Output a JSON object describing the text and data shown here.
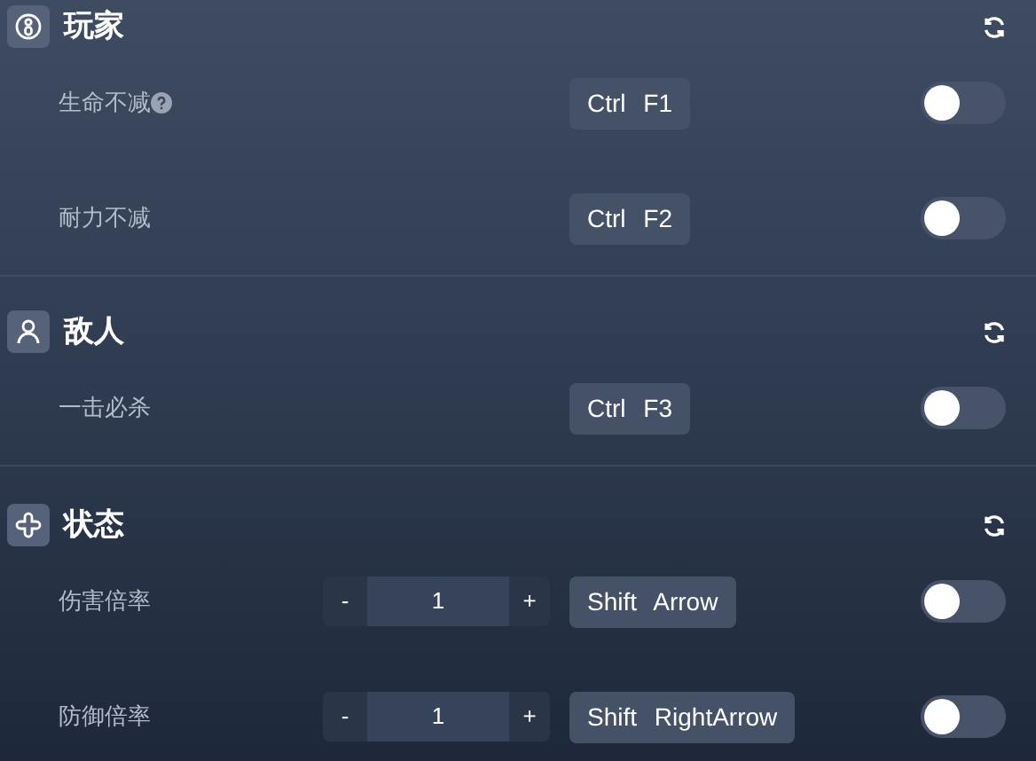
{
  "sections": [
    {
      "title": "玩家",
      "kind": "player",
      "rows": [
        {
          "label": "生命不减",
          "help": true,
          "hotkey": "Ctrl F1",
          "on": false
        },
        {
          "label": "耐力不减",
          "help": false,
          "hotkey": "Ctrl F2",
          "on": false
        }
      ]
    },
    {
      "title": "敌人",
      "kind": "enemy",
      "rows": [
        {
          "label": "一击必杀",
          "help": false,
          "hotkey": "Ctrl F3",
          "on": false
        }
      ]
    },
    {
      "title": "状态",
      "kind": "status",
      "rows": [
        {
          "label": "伤害倍率",
          "help": false,
          "stepper": {
            "minus": "-",
            "value": "1",
            "plus": "+"
          },
          "hotkey": "Shift Arrow",
          "on": false
        },
        {
          "label": "防御倍率",
          "help": false,
          "stepper": {
            "minus": "-",
            "value": "1",
            "plus": "+"
          },
          "hotkey": "Shift RightArrow",
          "on": false
        }
      ]
    }
  ]
}
